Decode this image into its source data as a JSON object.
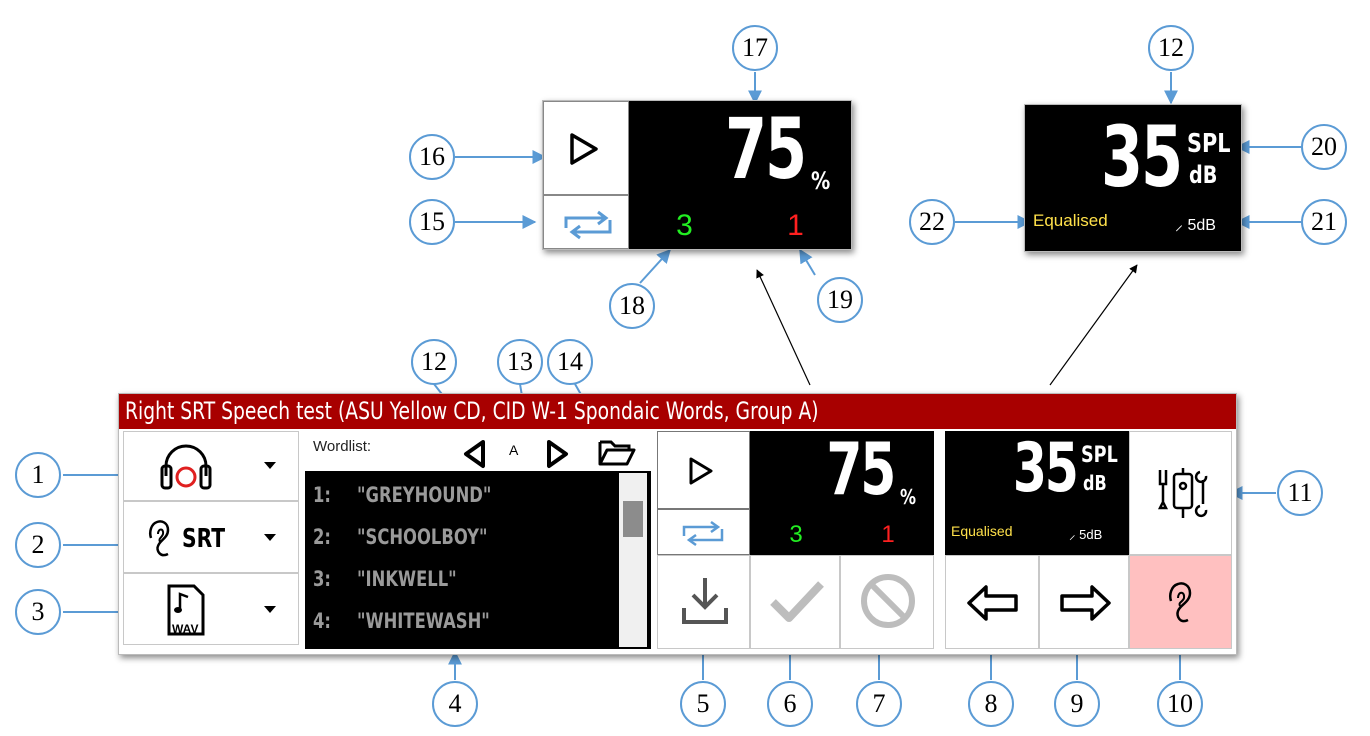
{
  "title": "Right SRT Speech test (ASU Yellow CD, CID W-1 Spondaic Words, Group A)",
  "left_controls": [
    {
      "icon": "headphones-icon"
    },
    {
      "icon": "ear-icon",
      "label": "SRT"
    },
    {
      "icon": "wav-file-icon",
      "file_label": "WAV"
    }
  ],
  "wordlist": {
    "label": "Wordlist:",
    "group": "A",
    "items": [
      {
        "num": "1:",
        "word": "\"GREYHOUND\""
      },
      {
        "num": "2:",
        "word": "\"SCHOOLBOY\""
      },
      {
        "num": "3:",
        "word": "\"INKWELL\""
      },
      {
        "num": "4:",
        "word": "\"WHITEWASH\""
      }
    ],
    "scroll_fraction": 0.1
  },
  "score": {
    "percent": "75",
    "percent_unit": "%",
    "correct": "3",
    "incorrect": "1"
  },
  "level": {
    "value": "35",
    "unit_top": "SPL",
    "unit_bottom": "dB",
    "mode": "Equalised",
    "step": "5dB"
  },
  "colors": {
    "title_bar": "#a80000",
    "correct": "#22ee22",
    "incorrect": "#ff2020",
    "equalised": "#ffe14a",
    "ear_cell": "#ffc0c0",
    "callout_border": "#5b9bd5"
  },
  "callouts": {
    "c1": "1",
    "c2": "2",
    "c3": "3",
    "c4": "4",
    "c5": "5",
    "c6": "6",
    "c7": "7",
    "c8": "8",
    "c9": "9",
    "c10": "10",
    "c11": "11",
    "c12a": "12",
    "c13": "13",
    "c14": "14",
    "c12b": "12",
    "c15": "15",
    "c16": "16",
    "c17": "17",
    "c18": "18",
    "c19": "19",
    "c20": "20",
    "c21": "21",
    "c22": "22"
  }
}
